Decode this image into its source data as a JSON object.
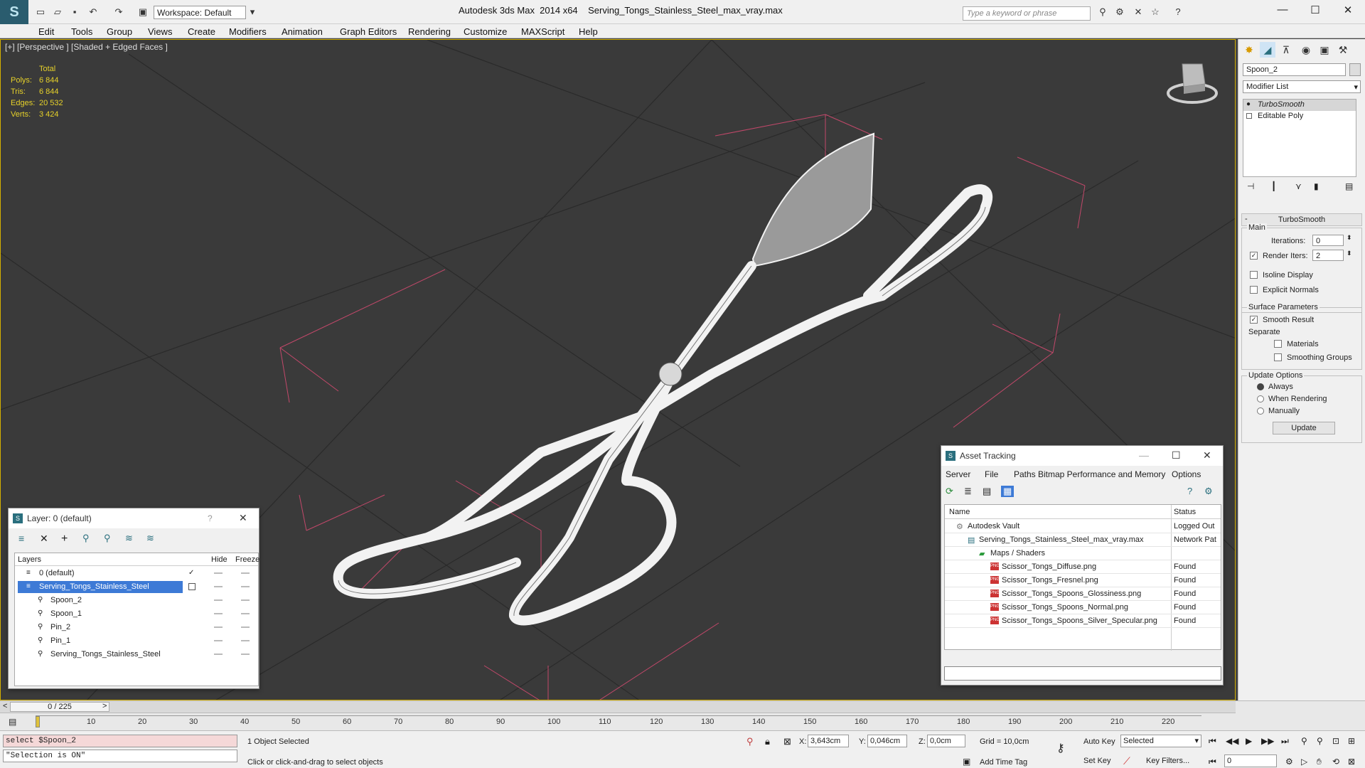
{
  "app": {
    "title": "Autodesk 3ds Max  2014 x64",
    "file": "Serving_Tongs_Stainless_Steel_max_vray.max",
    "workspace": "Workspace: Default",
    "search_placeholder": "Type a keyword or phrase"
  },
  "menu": [
    "Edit",
    "Tools",
    "Group",
    "Views",
    "Create",
    "Modifiers",
    "Animation",
    "Graph Editors",
    "Rendering",
    "Customize",
    "MAXScript",
    "Help"
  ],
  "viewport": {
    "label": "[+] [Perspective ] [Shaded + Edged Faces ]",
    "stats_header": "Total",
    "stats": [
      {
        "k": "Polys:",
        "v": "6 844"
      },
      {
        "k": "Tris:",
        "v": "6 844"
      },
      {
        "k": "Edges:",
        "v": "20 532"
      },
      {
        "k": "Verts:",
        "v": "3 424"
      }
    ]
  },
  "command_panel": {
    "object_name": "Spoon_2",
    "modifier_list": "Modifier List",
    "stack": [
      "TurboSmooth",
      "Editable Poly"
    ],
    "rollout_title": "TurboSmooth",
    "main_label": "Main",
    "iterations_label": "Iterations:",
    "iterations_value": "0",
    "render_iters_label": "Render Iters:",
    "render_iters_value": "2",
    "isoline": "Isoline Display",
    "explicit_normals": "Explicit Normals",
    "surface_params": "Surface Parameters",
    "smooth_result": "Smooth Result",
    "separate": "Separate",
    "materials": "Materials",
    "smoothing_groups": "Smoothing Groups",
    "update_options": "Update Options",
    "always": "Always",
    "when_rendering": "When Rendering",
    "manually": "Manually",
    "update_btn": "Update"
  },
  "layer_dialog": {
    "title": "Layer: 0 (default)",
    "help": "?",
    "col_layers": "Layers",
    "col_hide": "Hide",
    "col_freeze": "Freeze",
    "rows": [
      {
        "name": "0 (default)",
        "indent": 1,
        "selected": false,
        "check": "✓"
      },
      {
        "name": "Serving_Tongs_Stainless_Steel",
        "indent": 1,
        "selected": true,
        "check": ""
      },
      {
        "name": "Spoon_2",
        "indent": 2,
        "selected": false,
        "check": ""
      },
      {
        "name": "Spoon_1",
        "indent": 2,
        "selected": false,
        "check": ""
      },
      {
        "name": "Pin_2",
        "indent": 2,
        "selected": false,
        "check": ""
      },
      {
        "name": "Pin_1",
        "indent": 2,
        "selected": false,
        "check": ""
      },
      {
        "name": "Serving_Tongs_Stainless_Steel",
        "indent": 2,
        "selected": false,
        "check": ""
      }
    ]
  },
  "asset_dialog": {
    "title": "Asset Tracking",
    "menu": [
      "Server",
      "File",
      "Paths",
      "Bitmap Performance and Memory",
      "Options"
    ],
    "col_name": "Name",
    "col_status": "Status",
    "rows": [
      {
        "name": "Autodesk Vault",
        "status": "Logged Out",
        "indent": 1,
        "icon": "vault"
      },
      {
        "name": "Serving_Tongs_Stainless_Steel_max_vray.max",
        "status": "Network Pat",
        "indent": 2,
        "icon": "max"
      },
      {
        "name": "Maps / Shaders",
        "status": "",
        "indent": 3,
        "icon": "folder"
      },
      {
        "name": "Scissor_Tongs_Diffuse.png",
        "status": "Found",
        "indent": 4,
        "icon": "png"
      },
      {
        "name": "Scissor_Tongs_Fresnel.png",
        "status": "Found",
        "indent": 4,
        "icon": "png"
      },
      {
        "name": "Scissor_Tongs_Spoons_Glossiness.png",
        "status": "Found",
        "indent": 4,
        "icon": "png"
      },
      {
        "name": "Scissor_Tongs_Spoons_Normal.png",
        "status": "Found",
        "indent": 4,
        "icon": "png"
      },
      {
        "name": "Scissor_Tongs_Spoons_Silver_Specular.png",
        "status": "Found",
        "indent": 4,
        "icon": "png"
      }
    ],
    "png_icon": "PNG"
  },
  "timeline": {
    "frame": "0 / 225",
    "ticks": [
      "10",
      "20",
      "30",
      "40",
      "50",
      "60",
      "70",
      "80",
      "90",
      "100",
      "110",
      "120",
      "130",
      "140",
      "150",
      "160",
      "170",
      "180",
      "190",
      "200",
      "210",
      "220"
    ]
  },
  "status": {
    "script_line1": "select $Spoon_2",
    "script_line2": "\"Selection is ON\"",
    "selected": "1 Object Selected",
    "prompt": "Click or click-and-drag to select objects",
    "x_label": "X:",
    "x_val": "3,643cm",
    "y_label": "Y:",
    "y_val": "0,046cm",
    "z_label": "Z:",
    "z_val": "0,0cm",
    "grid": "Grid = 10,0cm",
    "add_time_tag": "Add Time Tag",
    "auto_key": "Auto Key",
    "set_key": "Set Key",
    "selected_dd": "Selected",
    "key_filters": "Key Filters...",
    "frame_field": "0"
  }
}
